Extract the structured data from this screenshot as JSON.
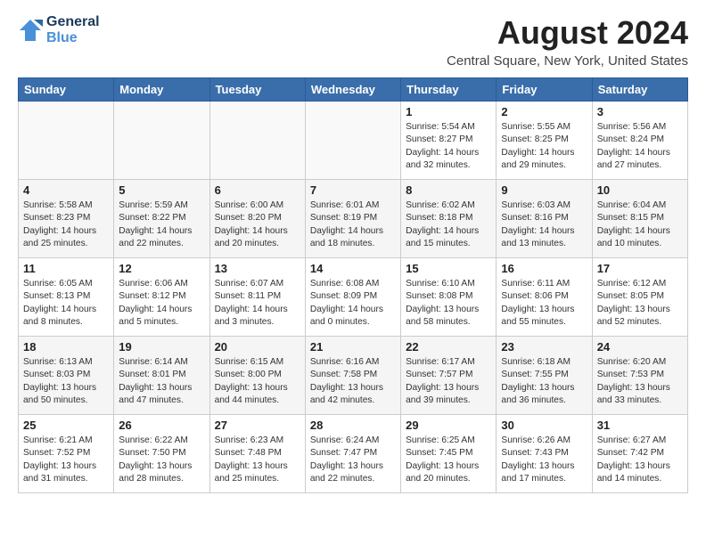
{
  "header": {
    "logo_line1": "General",
    "logo_line2": "Blue",
    "month_title": "August 2024",
    "subtitle": "Central Square, New York, United States"
  },
  "days_of_week": [
    "Sunday",
    "Monday",
    "Tuesday",
    "Wednesday",
    "Thursday",
    "Friday",
    "Saturday"
  ],
  "weeks": [
    [
      {
        "day": "",
        "content": ""
      },
      {
        "day": "",
        "content": ""
      },
      {
        "day": "",
        "content": ""
      },
      {
        "day": "",
        "content": ""
      },
      {
        "day": "1",
        "content": "Sunrise: 5:54 AM\nSunset: 8:27 PM\nDaylight: 14 hours\nand 32 minutes."
      },
      {
        "day": "2",
        "content": "Sunrise: 5:55 AM\nSunset: 8:25 PM\nDaylight: 14 hours\nand 29 minutes."
      },
      {
        "day": "3",
        "content": "Sunrise: 5:56 AM\nSunset: 8:24 PM\nDaylight: 14 hours\nand 27 minutes."
      }
    ],
    [
      {
        "day": "4",
        "content": "Sunrise: 5:58 AM\nSunset: 8:23 PM\nDaylight: 14 hours\nand 25 minutes."
      },
      {
        "day": "5",
        "content": "Sunrise: 5:59 AM\nSunset: 8:22 PM\nDaylight: 14 hours\nand 22 minutes."
      },
      {
        "day": "6",
        "content": "Sunrise: 6:00 AM\nSunset: 8:20 PM\nDaylight: 14 hours\nand 20 minutes."
      },
      {
        "day": "7",
        "content": "Sunrise: 6:01 AM\nSunset: 8:19 PM\nDaylight: 14 hours\nand 18 minutes."
      },
      {
        "day": "8",
        "content": "Sunrise: 6:02 AM\nSunset: 8:18 PM\nDaylight: 14 hours\nand 15 minutes."
      },
      {
        "day": "9",
        "content": "Sunrise: 6:03 AM\nSunset: 8:16 PM\nDaylight: 14 hours\nand 13 minutes."
      },
      {
        "day": "10",
        "content": "Sunrise: 6:04 AM\nSunset: 8:15 PM\nDaylight: 14 hours\nand 10 minutes."
      }
    ],
    [
      {
        "day": "11",
        "content": "Sunrise: 6:05 AM\nSunset: 8:13 PM\nDaylight: 14 hours\nand 8 minutes."
      },
      {
        "day": "12",
        "content": "Sunrise: 6:06 AM\nSunset: 8:12 PM\nDaylight: 14 hours\nand 5 minutes."
      },
      {
        "day": "13",
        "content": "Sunrise: 6:07 AM\nSunset: 8:11 PM\nDaylight: 14 hours\nand 3 minutes."
      },
      {
        "day": "14",
        "content": "Sunrise: 6:08 AM\nSunset: 8:09 PM\nDaylight: 14 hours\nand 0 minutes."
      },
      {
        "day": "15",
        "content": "Sunrise: 6:10 AM\nSunset: 8:08 PM\nDaylight: 13 hours\nand 58 minutes."
      },
      {
        "day": "16",
        "content": "Sunrise: 6:11 AM\nSunset: 8:06 PM\nDaylight: 13 hours\nand 55 minutes."
      },
      {
        "day": "17",
        "content": "Sunrise: 6:12 AM\nSunset: 8:05 PM\nDaylight: 13 hours\nand 52 minutes."
      }
    ],
    [
      {
        "day": "18",
        "content": "Sunrise: 6:13 AM\nSunset: 8:03 PM\nDaylight: 13 hours\nand 50 minutes."
      },
      {
        "day": "19",
        "content": "Sunrise: 6:14 AM\nSunset: 8:01 PM\nDaylight: 13 hours\nand 47 minutes."
      },
      {
        "day": "20",
        "content": "Sunrise: 6:15 AM\nSunset: 8:00 PM\nDaylight: 13 hours\nand 44 minutes."
      },
      {
        "day": "21",
        "content": "Sunrise: 6:16 AM\nSunset: 7:58 PM\nDaylight: 13 hours\nand 42 minutes."
      },
      {
        "day": "22",
        "content": "Sunrise: 6:17 AM\nSunset: 7:57 PM\nDaylight: 13 hours\nand 39 minutes."
      },
      {
        "day": "23",
        "content": "Sunrise: 6:18 AM\nSunset: 7:55 PM\nDaylight: 13 hours\nand 36 minutes."
      },
      {
        "day": "24",
        "content": "Sunrise: 6:20 AM\nSunset: 7:53 PM\nDaylight: 13 hours\nand 33 minutes."
      }
    ],
    [
      {
        "day": "25",
        "content": "Sunrise: 6:21 AM\nSunset: 7:52 PM\nDaylight: 13 hours\nand 31 minutes."
      },
      {
        "day": "26",
        "content": "Sunrise: 6:22 AM\nSunset: 7:50 PM\nDaylight: 13 hours\nand 28 minutes."
      },
      {
        "day": "27",
        "content": "Sunrise: 6:23 AM\nSunset: 7:48 PM\nDaylight: 13 hours\nand 25 minutes."
      },
      {
        "day": "28",
        "content": "Sunrise: 6:24 AM\nSunset: 7:47 PM\nDaylight: 13 hours\nand 22 minutes."
      },
      {
        "day": "29",
        "content": "Sunrise: 6:25 AM\nSunset: 7:45 PM\nDaylight: 13 hours\nand 20 minutes."
      },
      {
        "day": "30",
        "content": "Sunrise: 6:26 AM\nSunset: 7:43 PM\nDaylight: 13 hours\nand 17 minutes."
      },
      {
        "day": "31",
        "content": "Sunrise: 6:27 AM\nSunset: 7:42 PM\nDaylight: 13 hours\nand 14 minutes."
      }
    ]
  ]
}
